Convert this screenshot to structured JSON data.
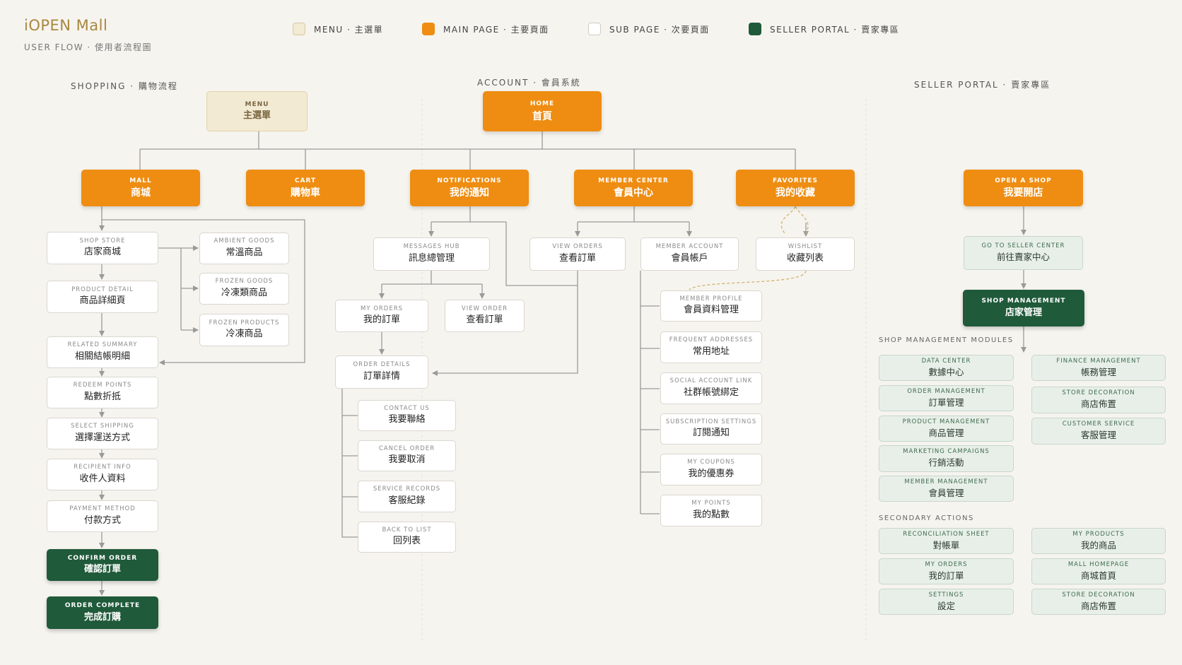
{
  "header": {
    "title": "iOPEN Mall",
    "subtitle": "USER FLOW · 使用者流程圖"
  },
  "legend": [
    {
      "label": "MENU · 主選單",
      "color": "#f3ead4"
    },
    {
      "label": "MAIN PAGE · 主要頁面",
      "color": "#ee8d12"
    },
    {
      "label": "SUB PAGE · 次要頁面",
      "color": "#ffffff"
    },
    {
      "label": "SELLER PORTAL · 賣家專區",
      "color": "#1f5a3a"
    }
  ],
  "sections": {
    "shopping": "SHOPPING · 購物流程",
    "account": "ACCOUNT · 會員系統",
    "seller": "SELLER PORTAL · 賣家專區",
    "modules": "SHOP MANAGEMENT MODULES",
    "secondary": "SECONDARY ACTIONS"
  },
  "nodes": {
    "menu": {
      "en": "MENU",
      "zh": "主選單"
    },
    "home": {
      "en": "HOME",
      "zh": "首頁"
    },
    "mall": {
      "en": "MALL",
      "zh": "商城"
    },
    "cart": {
      "en": "CART",
      "zh": "購物車"
    },
    "notifications": {
      "en": "NOTIFICATIONS",
      "zh": "我的通知"
    },
    "member_center": {
      "en": "MEMBER CENTER",
      "zh": "會員中心"
    },
    "favorites": {
      "en": "FAVORITES",
      "zh": "我的收藏"
    },
    "open_shop": {
      "en": "OPEN A SHOP",
      "zh": "我要開店"
    },
    "shop_store": {
      "en": "SHOP STORE",
      "zh": "店家商城"
    },
    "product_detail": {
      "en": "PRODUCT DETAIL",
      "zh": "商品詳細頁"
    },
    "related_summary": {
      "en": "RELATED SUMMARY",
      "zh": "相關結帳明細"
    },
    "redeem_points": {
      "en": "REDEEM POINTS",
      "zh": "點數折抵"
    },
    "select_shipping": {
      "en": "SELECT SHIPPING",
      "zh": "選擇運送方式"
    },
    "recipient_info": {
      "en": "RECIPIENT INFO",
      "zh": "收件人資料"
    },
    "payment_method": {
      "en": "PAYMENT METHOD",
      "zh": "付款方式"
    },
    "confirm_order": {
      "en": "CONFIRM ORDER",
      "zh": "確認訂單"
    },
    "order_complete": {
      "en": "ORDER COMPLETE",
      "zh": "完成訂購"
    },
    "ambient_goods": {
      "en": "AMBIENT GOODS",
      "zh": "常溫商品"
    },
    "frozen_goods": {
      "en": "FROZEN GOODS",
      "zh": "冷凍類商品"
    },
    "frozen_products": {
      "en": "FROZEN PRODUCTS",
      "zh": "冷凍商品"
    },
    "messages_hub": {
      "en": "MESSAGES HUB",
      "zh": "訊息總管理"
    },
    "my_orders": {
      "en": "MY ORDERS",
      "zh": "我的訂單"
    },
    "view_order": {
      "en": "VIEW ORDER",
      "zh": "查看訂單"
    },
    "order_details": {
      "en": "ORDER DETAILS",
      "zh": "訂單詳情"
    },
    "contact_us": {
      "en": "CONTACT US",
      "zh": "我要聯絡"
    },
    "cancel_order": {
      "en": "CANCEL ORDER",
      "zh": "我要取消"
    },
    "service_records": {
      "en": "SERVICE RECORDS",
      "zh": "客服紀錄"
    },
    "back_to_list": {
      "en": "BACK TO LIST",
      "zh": "回列表"
    },
    "view_orders": {
      "en": "VIEW ORDERS",
      "zh": "查看訂單"
    },
    "member_account": {
      "en": "MEMBER ACCOUNT",
      "zh": "會員帳戶"
    },
    "wishlist": {
      "en": "WISHLIST",
      "zh": "收藏列表"
    },
    "member_profile": {
      "en": "MEMBER PROFILE",
      "zh": "會員資料管理"
    },
    "frequent_addresses": {
      "en": "FREQUENT ADDRESSES",
      "zh": "常用地址"
    },
    "social_account_link": {
      "en": "SOCIAL ACCOUNT LINK",
      "zh": "社群帳號綁定"
    },
    "subscription_settings": {
      "en": "SUBSCRIPTION SETTINGS",
      "zh": "訂閱通知"
    },
    "my_coupons": {
      "en": "MY COUPONS",
      "zh": "我的優惠券"
    },
    "my_points": {
      "en": "MY POINTS",
      "zh": "我的點數"
    },
    "seller_center": {
      "en": "GO TO SELLER CENTER",
      "zh": "前往賣家中心"
    },
    "shop_management": {
      "en": "SHOP MANAGEMENT",
      "zh": "店家管理"
    },
    "data_center": {
      "en": "DATA CENTER",
      "zh": "數據中心"
    },
    "order_management": {
      "en": "ORDER MANAGEMENT",
      "zh": "訂單管理"
    },
    "product_management": {
      "en": "PRODUCT MANAGEMENT",
      "zh": "商品管理"
    },
    "marketing_campaigns": {
      "en": "MARKETING CAMPAIGNS",
      "zh": "行銷活動"
    },
    "member_management": {
      "en": "MEMBER MANAGEMENT",
      "zh": "會員管理"
    },
    "finance_management": {
      "en": "FINANCE MANAGEMENT",
      "zh": "帳務管理"
    },
    "store_decoration": {
      "en": "STORE DECORATION",
      "zh": "商店佈置"
    },
    "customer_service": {
      "en": "CUSTOMER SERVICE",
      "zh": "客服管理"
    },
    "reconciliation_sheet": {
      "en": "RECONCILIATION SHEET",
      "zh": "對帳單"
    },
    "sa_my_orders": {
      "en": "MY ORDERS",
      "zh": "我的訂單"
    },
    "sa_settings": {
      "en": "SETTINGS",
      "zh": "設定"
    },
    "sa_my_products": {
      "en": "MY PRODUCTS",
      "zh": "我的商品"
    },
    "sa_mall_homepage": {
      "en": "MALL HOMEPAGE",
      "zh": "商城首頁"
    },
    "sa_store_decoration": {
      "en": "STORE DECORATION",
      "zh": "商店佈置"
    }
  }
}
